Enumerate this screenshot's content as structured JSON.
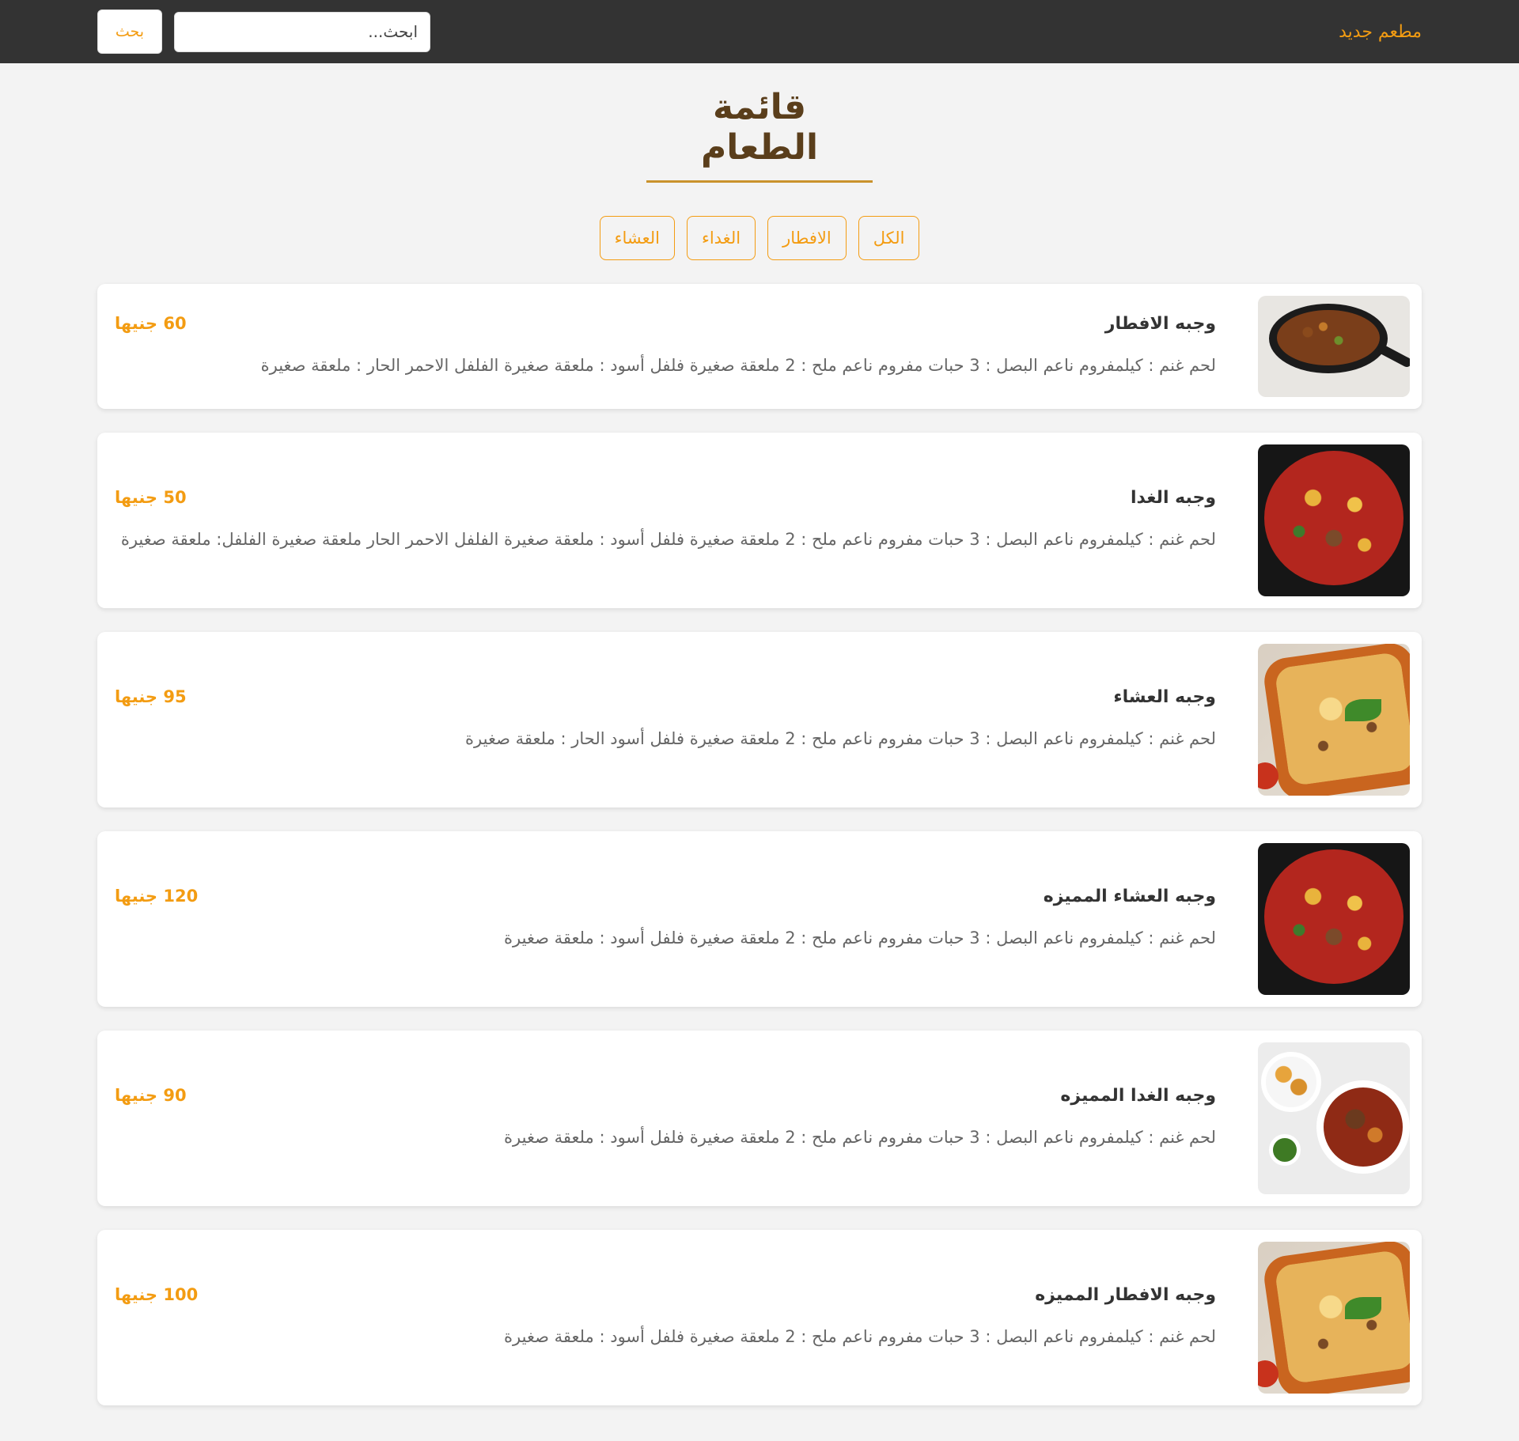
{
  "nav": {
    "brand": "مطعم جديد",
    "search_placeholder": "ابحث...",
    "search_button": "بحث"
  },
  "page": {
    "title": "قائمة الطعام"
  },
  "filters": [
    "الكل",
    "الافطار",
    "الغداء",
    "العشاء"
  ],
  "menu_items": [
    {
      "name": "وجبه الافطار",
      "price": "60 جنيها",
      "description": "لحم غنم : كيلمفروم ناعم البصل : 3 حبات مفروم ناعم ملح : 2 ملعقة صغيرة فلفل أسود : ملعقة صغيرة الفلفل الاحمر الحار : ملعقة صغيرة",
      "image": "skillet"
    },
    {
      "name": "وجبه الغدا",
      "price": "50 جنيها",
      "description": "لحم غنم : كيلمفروم ناعم البصل : 3 حبات مفروم ناعم ملح : 2 ملعقة صغيرة فلفل أسود : ملعقة صغيرة الفلفل الاحمر الحار ملعقة صغيرة الفلفل: ملعقة صغيرة",
      "image": "plate"
    },
    {
      "name": "وجبه العشاء",
      "price": "95 جنيها",
      "description": "لحم غنم : كيلمفروم ناعم البصل : 3 حبات مفروم ناعم ملح : 2 ملعقة صغيرة فلفل أسود الحار : ملعقة صغيرة",
      "image": "bake"
    },
    {
      "name": "وجبه العشاء المميزه",
      "price": "120 جنيها",
      "description": "لحم غنم : كيلمفروم ناعم البصل : 3 حبات مفروم ناعم ملح : 2 ملعقة صغيرة فلفل أسود : ملعقة صغيرة",
      "image": "plate"
    },
    {
      "name": "وجبه الغدا المميزه",
      "price": "90 جنيها",
      "description": "لحم غنم : كيلمفروم ناعم البصل : 3 حبات مفروم ناعم ملح : 2 ملعقة صغيرة فلفل أسود : ملعقة صغيرة",
      "image": "stew"
    },
    {
      "name": "وجبه الافطار المميزه",
      "price": "100 جنيها",
      "description": "لحم غنم : كيلمفروم ناعم البصل : 3 حبات مفروم ناعم ملح : 2 ملعقة صغيرة فلفل أسود : ملعقة صغيرة",
      "image": "bake"
    }
  ],
  "colors": {
    "navbar": "#333333",
    "accent": "#f39c12",
    "title": "#5a3e1b",
    "title_underline": "#c9922c",
    "background": "#f3f3f3"
  }
}
